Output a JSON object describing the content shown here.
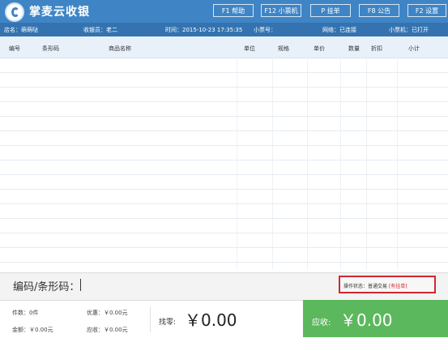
{
  "app": {
    "title": "掌麦云收银"
  },
  "toolbar": {
    "buttons": [
      {
        "label": "F1 帮助"
      },
      {
        "label": "F12 小票机"
      },
      {
        "label": "P 挂单"
      },
      {
        "label": "F8 公告"
      },
      {
        "label": "F2 设置"
      }
    ]
  },
  "info": {
    "store": "店名：萌萌哒",
    "cashier": "收银员：老二",
    "time": "时间：2015-10-23 17:35:35",
    "ticket": "小票号：",
    "network": "网络：已连接",
    "printer": "小票机：已打开"
  },
  "table": {
    "columns": [
      "编号",
      "条形码",
      "商品名称",
      "单位",
      "规格",
      "单价",
      "数量",
      "折扣",
      "小计"
    ],
    "rows": []
  },
  "input": {
    "label": "编码/条形码："
  },
  "status": {
    "text": "操作状态：普通交易",
    "flag": "[有挂单]"
  },
  "footer": {
    "count": "件数：0件",
    "discount": "优惠：￥0.00元",
    "amount": "金额：￥0.00元",
    "receivable_small": "应收：￥0.00元",
    "change_label": "找零:",
    "change_value": "￥0.00",
    "receivable_label": "应收:",
    "receivable_value": "￥0.00"
  },
  "colors": {
    "header": "#3f85c6",
    "receivable": "#5cb85c",
    "status_border": "#d0282d"
  },
  "icons": {
    "logo": "app-logo-icon"
  }
}
